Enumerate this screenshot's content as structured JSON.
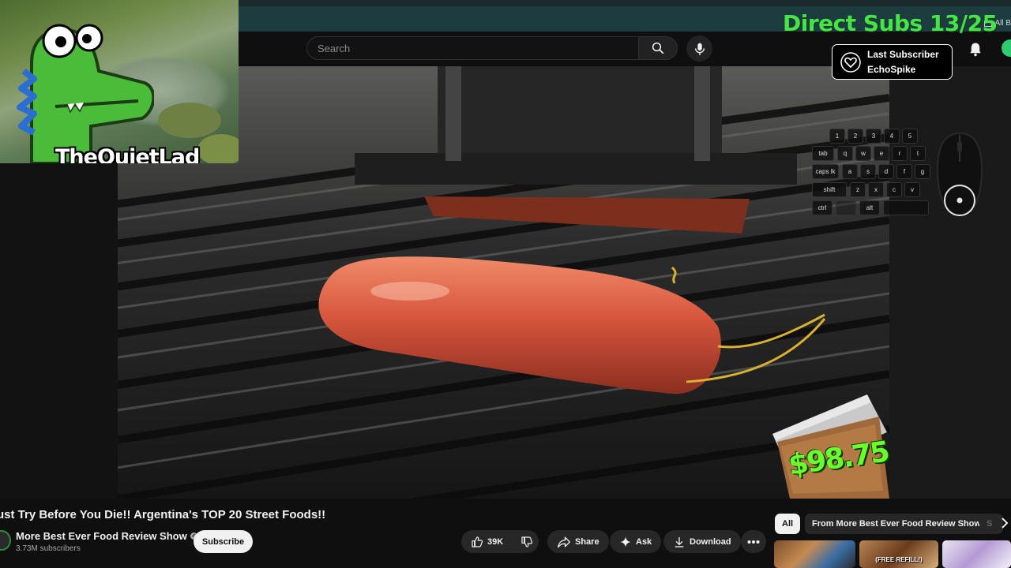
{
  "browser": {
    "bookmarks_label": "All B"
  },
  "search": {
    "placeholder": "Search"
  },
  "stream_overlay": {
    "brand": "TheQuietLad",
    "direct_subs": "Direct Subs 13/25",
    "last_subscriber_title": "Last Subscriber",
    "last_subscriber_name": "EchoSpike",
    "cash_amount": "$98.75",
    "keyboard": {
      "row1": [
        "1",
        "2",
        "3",
        "4",
        "5"
      ],
      "row2": [
        "tab",
        "q",
        "w",
        "e",
        "r",
        "t"
      ],
      "row3": [
        "caps lk",
        "a",
        "s",
        "d",
        "f",
        "g"
      ],
      "row4": [
        "shift",
        "z",
        "x",
        "c",
        "v"
      ],
      "row5": [
        "ctrl",
        "alt"
      ]
    }
  },
  "video": {
    "title": "ust Try Before You Die!! Argentina's TOP 20 Street Foods!!",
    "channel_name": "More Best Ever Food Review Show",
    "subscribers": "3.73M subscribers",
    "subscribe_label": "Subscribe",
    "likes": "39K",
    "share_label": "Share",
    "ask_label": "Ask",
    "download_label": "Download"
  },
  "recommendations": {
    "chips": [
      "All",
      "From More Best Ever Food Review Show",
      "S"
    ],
    "thumb_label": "(FREE REFILL!)"
  },
  "colors": {
    "accent_green": "#48e24a",
    "cash_green": "#6aff2e",
    "bg": "#0f0f0f"
  }
}
